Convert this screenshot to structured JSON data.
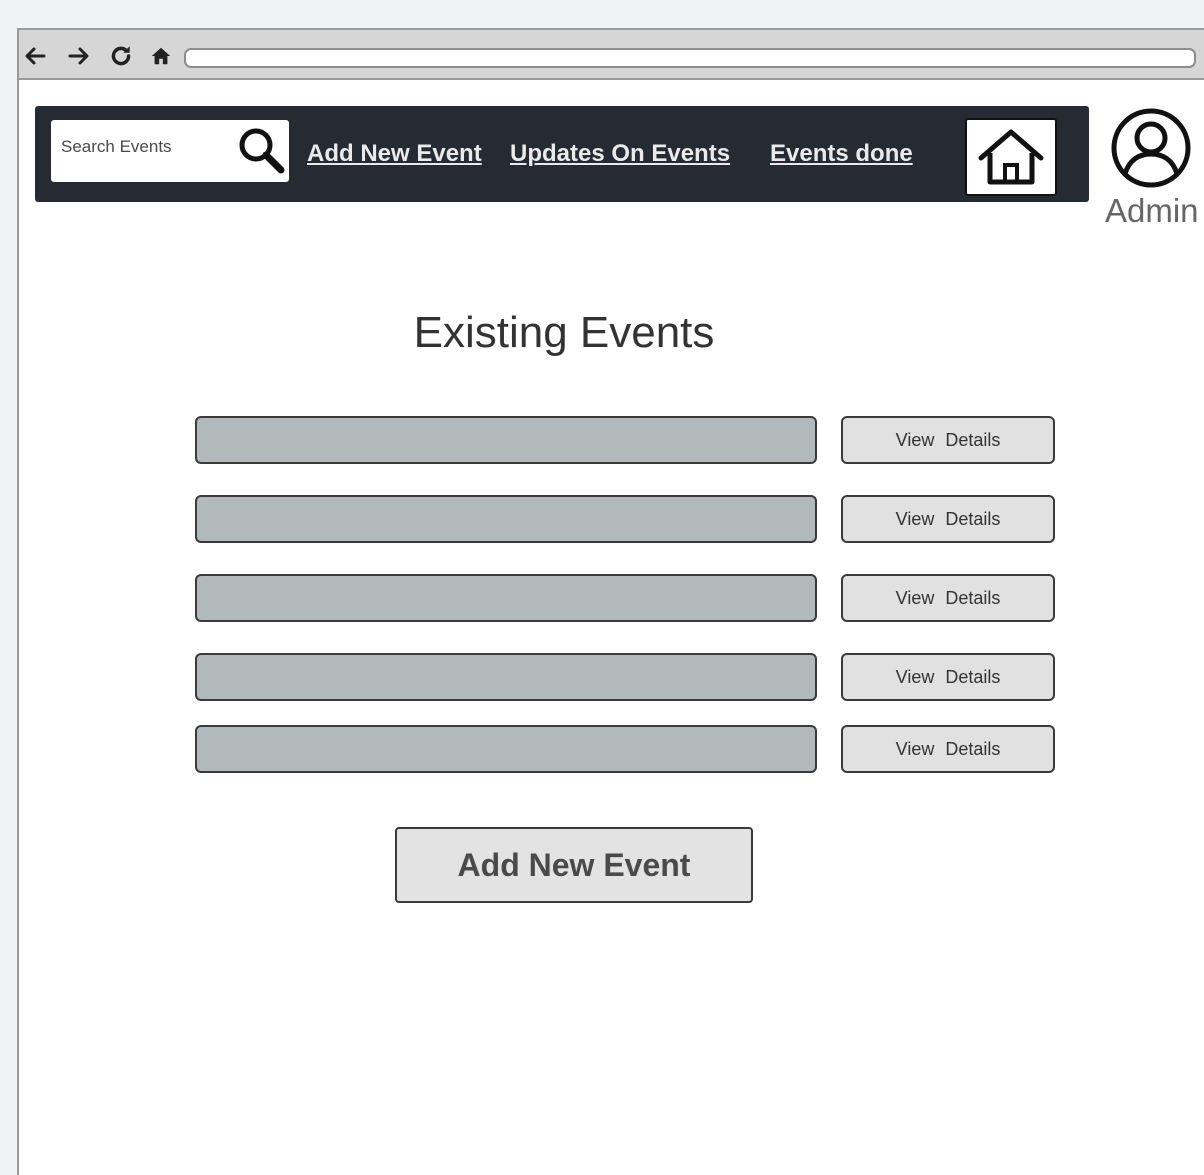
{
  "browser": {
    "back_icon": "arrow-left-icon",
    "forward_icon": "arrow-right-icon",
    "reload_icon": "reload-icon",
    "home_icon": "home-icon",
    "address": ""
  },
  "navbar": {
    "background": "#252a33",
    "search": {
      "placeholder": "Search Events",
      "icon": "search-icon"
    },
    "links": [
      {
        "label": "Add New Event"
      },
      {
        "label": "Updates On Events"
      },
      {
        "label": "Events done"
      }
    ],
    "home_icon": "house-icon"
  },
  "user": {
    "label": "Admin",
    "icon": "user-avatar-icon"
  },
  "main": {
    "title": "Existing Events",
    "events": [
      {
        "value": "",
        "action_label": "View  Details"
      },
      {
        "value": "",
        "action_label": "View  Details"
      },
      {
        "value": "",
        "action_label": "View  Details"
      },
      {
        "value": "",
        "action_label": "View  Details"
      },
      {
        "value": "",
        "action_label": "View  Details"
      }
    ],
    "add_button_label": "Add New Event"
  }
}
